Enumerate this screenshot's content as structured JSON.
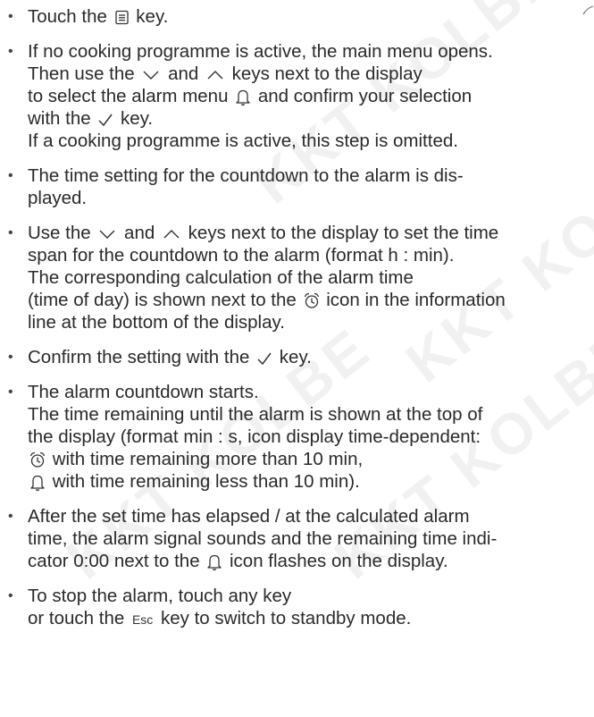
{
  "watermark": {
    "text": "KKT KOLBE"
  },
  "steps": [
    {
      "lines": [
        [
          "Touch the ",
          "{menu-icon}",
          " key."
        ]
      ]
    },
    {
      "lines": [
        [
          "If no cooking programme is active, the main menu opens."
        ],
        [
          "Then use the ",
          "{chevron-down-icon}",
          " and ",
          "{chevron-up-icon}",
          " keys next to the display"
        ],
        [
          "to select the alarm menu ",
          "{bell-icon}",
          " and confirm your selection"
        ],
        [
          "with the ",
          "{check-icon}",
          " key."
        ],
        [
          "If a cooking programme is active, this step is omitted."
        ]
      ]
    },
    {
      "lines": [
        [
          "The time setting for the countdown to the alarm is dis-"
        ],
        [
          "played."
        ]
      ]
    },
    {
      "lines": [
        [
          "Use the ",
          "{chevron-down-icon}",
          " and ",
          "{chevron-up-icon}",
          "  keys next to the display to set the time"
        ],
        [
          "span for the countdown to the alarm (format h : min)."
        ],
        [
          "The corresponding calculation of the alarm time"
        ],
        [
          "(time of day) is shown next to the ",
          "{alarm-clock-icon}",
          " icon in the information"
        ],
        [
          "line at the bottom of the display."
        ]
      ]
    },
    {
      "lines": [
        [
          "Confirm the setting with the ",
          "{check-icon}",
          " key."
        ]
      ]
    },
    {
      "lines": [
        [
          "The alarm countdown starts."
        ],
        [
          "The time remaining until the alarm is shown at the top of"
        ],
        [
          "the display (format min : s, icon display time-dependent:"
        ],
        [
          "{alarm-clock-icon}",
          " with time remaining more than 10 min,"
        ],
        [
          "{bell-icon}",
          " with time remaining less than 10 min)."
        ]
      ]
    },
    {
      "lines": [
        [
          "After the set time has elapsed / at the calculated alarm"
        ],
        [
          "time, the alarm signal sounds and the remaining time indi-"
        ],
        [
          "cator 0:00 next to the ",
          "{bell-icon}",
          " icon flashes on the display."
        ]
      ]
    },
    {
      "lines": [
        [
          "To stop the alarm, touch any key"
        ],
        [
          "or touch the ",
          "{esc-key}",
          " key to switch to standby mode."
        ]
      ]
    }
  ],
  "esc_key_label": "Esc",
  "bullet": "•",
  "colors": {
    "text": "#2a2a2a",
    "watermark": "#f1f1f1"
  }
}
